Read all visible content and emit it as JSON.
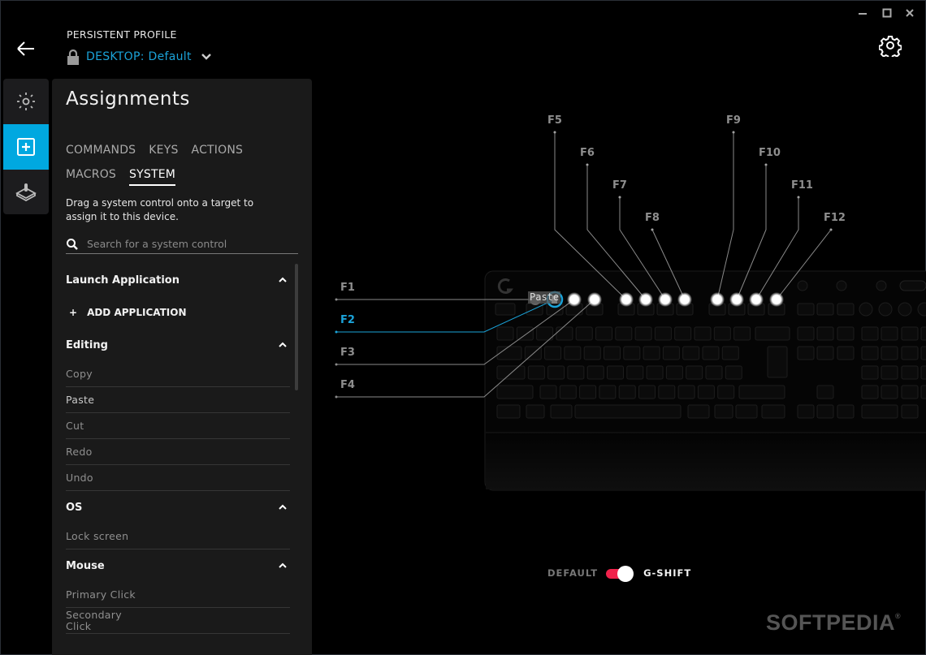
{
  "window": {
    "controls": {
      "minimize": "minimize",
      "maximize": "maximize",
      "close": "close"
    }
  },
  "header": {
    "profile_label": "PERSISTENT PROFILE",
    "profile_prefix": "DESKTOP:",
    "profile_name": "Default"
  },
  "rail": {
    "items": [
      {
        "name": "lighting",
        "icon": "sun-icon",
        "active": false
      },
      {
        "name": "assignments",
        "icon": "plus-square-icon",
        "active": true
      },
      {
        "name": "game-mode",
        "icon": "joystick-icon",
        "active": false
      }
    ]
  },
  "panel": {
    "title": "Assignments",
    "tabs_row1": [
      "COMMANDS",
      "KEYS",
      "ACTIONS"
    ],
    "tabs_row2": [
      "MACROS",
      "SYSTEM"
    ],
    "active_tab": "SYSTEM",
    "description": "Drag a system control onto a target to assign it to this device.",
    "search_placeholder": "Search for a system control",
    "sections": {
      "launch": {
        "title": "Launch Application",
        "add_label": "ADD APPLICATION"
      },
      "editing": {
        "title": "Editing",
        "items": [
          "Copy",
          "Paste",
          "Cut",
          "Redo",
          "Undo"
        ]
      },
      "os": {
        "title": "OS",
        "items": [
          "Lock screen"
        ]
      },
      "mouse": {
        "title": "Mouse",
        "items": [
          "Primary Click",
          "Secondary Click"
        ]
      }
    }
  },
  "keyboard": {
    "fkeys": [
      "F1",
      "F2",
      "F3",
      "F4",
      "F5",
      "F6",
      "F7",
      "F8",
      "F9",
      "F10",
      "F11",
      "F12"
    ],
    "selected_fkey": "F2",
    "assigned_tooltip": "Paste",
    "accent": "#1ba3d9"
  },
  "mode_toggle": {
    "left_label": "DEFAULT",
    "right_label": "G-SHIFT",
    "state": "G-SHIFT",
    "on_color": "#f0224b"
  },
  "watermark": "SOFTPEDIA"
}
